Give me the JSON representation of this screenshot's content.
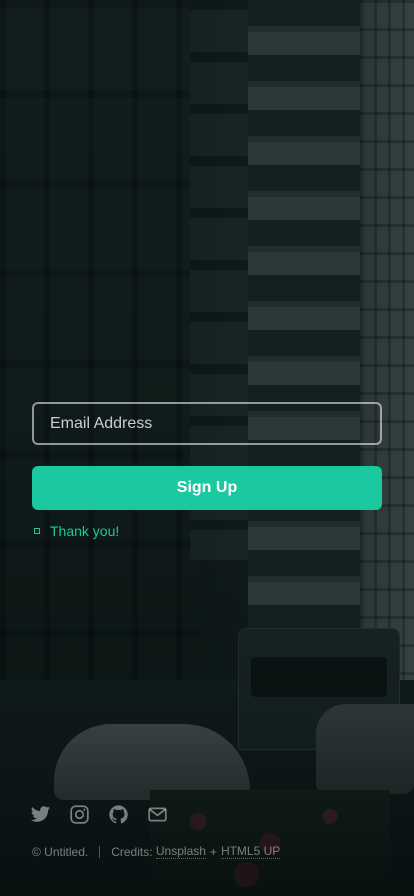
{
  "form": {
    "email_placeholder": "Email Address",
    "submit_label": "Sign Up",
    "message": "Thank you!"
  },
  "social": {
    "icons": [
      "twitter-icon",
      "instagram-icon",
      "github-icon",
      "envelope-icon"
    ]
  },
  "footer": {
    "copyright": "© Untitled.",
    "credits_label": "Credits:",
    "credit_links": [
      "Unsplash",
      "HTML5 UP"
    ],
    "credit_joiner": "+"
  },
  "colors": {
    "accent": "#1cc8a0",
    "background": "#0b1414"
  }
}
